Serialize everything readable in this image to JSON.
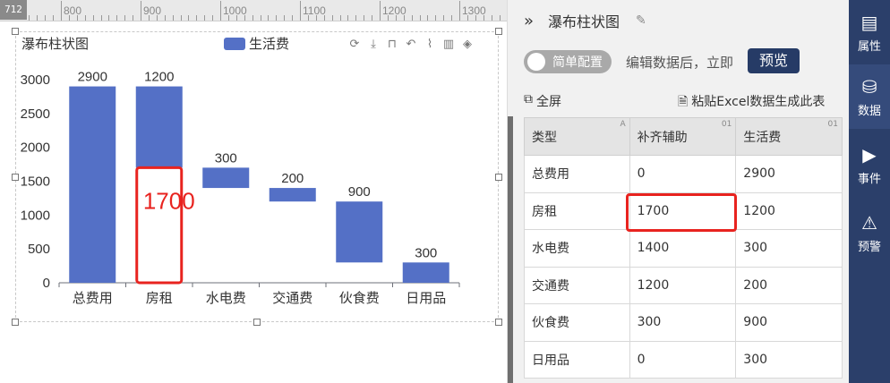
{
  "ruler": {
    "badge": "712",
    "labels": [
      "800",
      "900",
      "1000",
      "1100",
      "1200",
      "1300"
    ]
  },
  "chart": {
    "title": "瀑布柱状图",
    "legend_label": "生活费",
    "highlight_label": "1700",
    "bar_color": "#5470c6",
    "highlight_color": "#e8231f"
  },
  "chart_data": {
    "type": "bar",
    "title": "瀑布柱状图",
    "categories": [
      "总费用",
      "房租",
      "水电费",
      "交通费",
      "伙食费",
      "日用品"
    ],
    "series": [
      {
        "name": "补齐辅助",
        "values": [
          0,
          1700,
          1400,
          1200,
          300,
          0
        ],
        "visible": false
      },
      {
        "name": "生活费",
        "values": [
          2900,
          1200,
          300,
          200,
          900,
          300
        ]
      }
    ],
    "stacked": true,
    "ylim": [
      0,
      3000
    ],
    "yticks": [
      0,
      500,
      1000,
      1500,
      2000,
      2500,
      3000
    ],
    "legend": "top-center",
    "grid": false
  },
  "panel": {
    "title": "瀑布柱状图",
    "toggle_label": "简单配置",
    "hint": "编辑数据后，立即",
    "preview_label": "预览",
    "fullscreen_label": "全屏",
    "paste_label": "粘贴Excel数据生成此表",
    "headers": [
      "类型",
      "补齐辅助",
      "生活费"
    ],
    "rows": [
      [
        "总费用",
        "0",
        "2900"
      ],
      [
        "房租",
        "1700",
        "1200"
      ],
      [
        "水电费",
        "1400",
        "300"
      ],
      [
        "交通费",
        "1200",
        "200"
      ],
      [
        "伙食费",
        "300",
        "900"
      ],
      [
        "日用品",
        "0",
        "300"
      ]
    ]
  },
  "sidebar": {
    "items": [
      {
        "label": "属性",
        "icon": "properties-icon"
      },
      {
        "label": "数据",
        "icon": "database-icon"
      },
      {
        "label": "事件",
        "icon": "event-icon"
      },
      {
        "label": "预警",
        "icon": "alarm-icon"
      }
    ]
  }
}
